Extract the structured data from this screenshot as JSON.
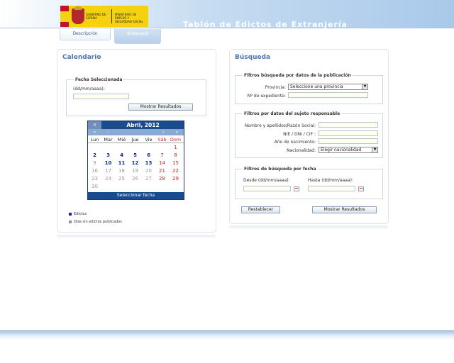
{
  "header": {
    "logo_text_1": "Gobierno de España",
    "logo_text_2": "Ministerio de Empleo y Seguridad Social",
    "title": "Tablón de Edictos de Extranjería"
  },
  "tabs": [
    {
      "label": "Descripción",
      "active": false
    },
    {
      "label": "Búsqueda",
      "active": true
    }
  ],
  "left_panel": {
    "title": "Calendario",
    "fecha": {
      "legend": "Fecha Seleccionada",
      "label": "(dd/mm/aaaa):",
      "value": "",
      "button": "Mostrar Resultados"
    },
    "calendar": {
      "close": "×",
      "title": "Abril, 2012",
      "nav": [
        "«",
        "‹",
        "",
        "›",
        "»"
      ],
      "weekdays": [
        "Lun",
        "Mar",
        "Mié",
        "Jue",
        "Vie",
        "Sáb",
        "Dom"
      ],
      "weeks": [
        [
          {
            "d": "",
            "t": ""
          },
          {
            "d": "",
            "t": ""
          },
          {
            "d": "",
            "t": ""
          },
          {
            "d": "",
            "t": ""
          },
          {
            "d": "",
            "t": ""
          },
          {
            "d": "",
            "t": ""
          },
          {
            "d": "1",
            "t": "weekend"
          }
        ],
        [
          {
            "d": "2",
            "t": "event"
          },
          {
            "d": "3",
            "t": "event"
          },
          {
            "d": "4",
            "t": "event"
          },
          {
            "d": "5",
            "t": "event"
          },
          {
            "d": "6",
            "t": "event"
          },
          {
            "d": "7",
            "t": "weekend"
          },
          {
            "d": "8",
            "t": "weekend"
          }
        ],
        [
          {
            "d": "9",
            "t": "off"
          },
          {
            "d": "10",
            "t": "event"
          },
          {
            "d": "11",
            "t": "event"
          },
          {
            "d": "12",
            "t": "event"
          },
          {
            "d": "13",
            "t": "event"
          },
          {
            "d": "14",
            "t": "weekend"
          },
          {
            "d": "15",
            "t": "weekend"
          }
        ],
        [
          {
            "d": "16",
            "t": "off"
          },
          {
            "d": "17",
            "t": "off"
          },
          {
            "d": "18",
            "t": "off"
          },
          {
            "d": "19",
            "t": "off"
          },
          {
            "d": "20",
            "t": "off"
          },
          {
            "d": "21",
            "t": "weekend"
          },
          {
            "d": "22",
            "t": "weekend"
          }
        ],
        [
          {
            "d": "23",
            "t": "off"
          },
          {
            "d": "24",
            "t": "off"
          },
          {
            "d": "25",
            "t": "off"
          },
          {
            "d": "26",
            "t": "off"
          },
          {
            "d": "27",
            "t": "off"
          },
          {
            "d": "28",
            "t": "weekend"
          },
          {
            "d": "29",
            "t": "weekend"
          }
        ],
        [
          {
            "d": "30",
            "t": "off"
          },
          {
            "d": "",
            "t": ""
          },
          {
            "d": "",
            "t": ""
          },
          {
            "d": "",
            "t": ""
          },
          {
            "d": "",
            "t": ""
          },
          {
            "d": "",
            "t": ""
          },
          {
            "d": "",
            "t": ""
          }
        ]
      ],
      "select_label": "Seleccionar fecha"
    },
    "legend": [
      {
        "label": "Edictos",
        "color": "#1a1ac8"
      },
      {
        "label": "Días sin edictos publicados",
        "color": "#a08aa0"
      }
    ]
  },
  "right_panel": {
    "title": "Búsqueda",
    "publicacion": {
      "legend": "Filtros búsqueda por datos de la publicación",
      "provincia_label": "Provincia:",
      "provincia_value": "Seleccione una provincia",
      "expediente_label": "Nº de expediente:",
      "expediente_value": ""
    },
    "sujeto": {
      "legend": "Filtros por datos del sujeto responsable",
      "nombre_label": "Nombre y apellidos/Razón Social:",
      "nie_label": "NIE / DNI / CIF :",
      "nacimiento_label": "Año de nacimiento:",
      "nacionalidad_label": "Nacionalidad:",
      "nacionalidad_value": "Elegir nacionalidad"
    },
    "fecha": {
      "legend": "Filtros de búsqueda por fecha",
      "desde_label": "Desde (dd/mm/aaaa):",
      "hasta_label": "Hasta (dd/mm/aaaa):"
    },
    "buttons": {
      "reset": "Restablecer",
      "submit": "Mostrar Resultados"
    }
  }
}
